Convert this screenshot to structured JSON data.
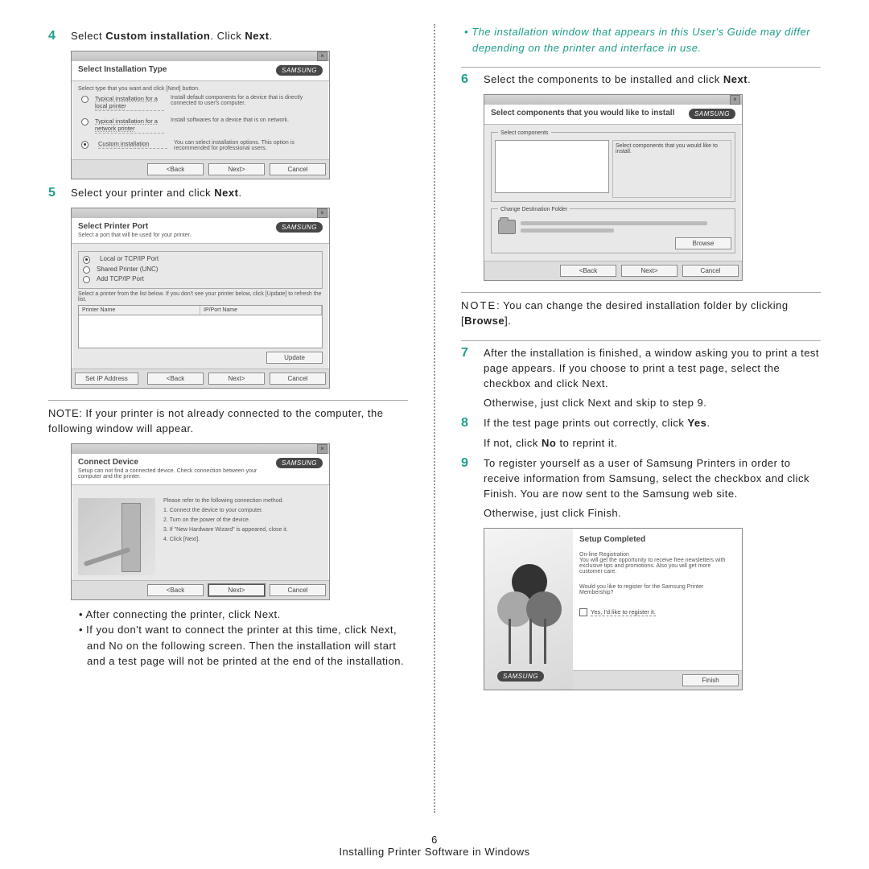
{
  "footer": {
    "pagenum": "6",
    "section": "Installing Printer Software in Windows"
  },
  "notes": {
    "printer_not_connected": "NOTE: If your printer is not already connected to the computer, the following window will appear.",
    "change_folder_a": "NOTE",
    "change_folder_b": ": You can change the desired installation folder by clicking [",
    "change_folder_c": "Browse",
    "change_folder_d": "]."
  },
  "left": {
    "step4": {
      "num": "4",
      "a": "Select ",
      "b": "Custom installation",
      "c": ". Click ",
      "d": "Next",
      "e": "."
    },
    "step5": {
      "num": "5",
      "a": "Select your printer and click ",
      "b": "Next",
      "c": "."
    },
    "bullets": {
      "b1": "• After connecting the printer, click Next.",
      "b2": "• If you don't want to connect the printer at this time, click Next, and No on the following screen. Then the installation will start and a test page will not be printed at the end of the installation."
    }
  },
  "right": {
    "topnote": "• The installation window that appears in this User's Guide may differ depending on the printer and interface in use.",
    "step6": {
      "num": "6",
      "a": "Select the components to be installed and click ",
      "b": "Next",
      "c": "."
    },
    "step7": {
      "num": "7",
      "txt": "After the installation is finished, a window asking you to print a test page appears. If you choose to print a test page, select the checkbox and click Next.",
      "txt2": "Otherwise, just click Next and skip to step 9."
    },
    "step8": {
      "num": "8",
      "a": "If the test page prints out correctly, click ",
      "b": "Yes",
      "c": ".",
      "line2a": "If not, click ",
      "line2b": "No",
      "line2c": " to reprint it."
    },
    "step9": {
      "num": "9",
      "txt": "To register yourself as a user of Samsung Printers in order to receive information from Samsung, select the checkbox and click Finish. You are now sent to the Samsung web site.",
      "txt2": "Otherwise, just click Finish."
    }
  },
  "brand": "SAMSUNG",
  "dlgA": {
    "title": "Select Installation Type",
    "intro": "Select type that you want and click [Next] button.",
    "opt1": "Typical installation for a local printer",
    "opt1d": "Install default components for a device that is directly connected to user's computer.",
    "opt2": "Typical installation for a network printer",
    "opt2d": "Install softwares for a device that is on network.",
    "opt3": "Custom installation",
    "opt3d": "You can select installation options. This option is recommended for professional users.",
    "back": "<Back",
    "next": "Next>",
    "cancel": "Cancel"
  },
  "dlgB": {
    "title": "Select Printer Port",
    "sub": "Select a port that will be used for your printer.",
    "r1": "Local or TCP/IP Port",
    "r2": "Shared Printer (UNC)",
    "r3": "Add TCP/IP Port",
    "help": "Select a printer from the list below. If you don't see your printer below, click [Update] to refresh the list.",
    "col1": "Printer Name",
    "col2": "IP/Port Name",
    "update": "Update",
    "setip": "Set IP Address",
    "back": "<Back",
    "next": "Next>",
    "cancel": "Cancel"
  },
  "dlgC": {
    "title": "Connect Device",
    "sub": "Setup can not find a connected device. Check connection between your computer and the printer.",
    "intro": "Please refer to the following connection method.",
    "l1": "1. Connect the device to your computer.",
    "l2": "2. Turn on the power of the device.",
    "l3": "3. If \"New Hardware Wizard\" is appeared, close it.",
    "l4": "4. Click [Next].",
    "back": "<Back",
    "next": "Next>",
    "cancel": "Cancel"
  },
  "dlgD": {
    "title": "Select components that you would like to install",
    "g1": "Select components",
    "g1r": "Select components that you would like to install.",
    "g2": "Change Destination Folder",
    "browse": "Browse",
    "back": "<Back",
    "next": "Next>",
    "cancel": "Cancel"
  },
  "dlgE": {
    "title": "Setup Completed",
    "l1": "On-line Registration",
    "l2": "You will get the opportunity to receive free newsletters with exclusive tips and promotions. Also you will get more customer care.",
    "l3": "Would you like to register for the Samsung Printer Membership?",
    "chk": "Yes, I'd like to register it.",
    "finish": "Finish"
  }
}
